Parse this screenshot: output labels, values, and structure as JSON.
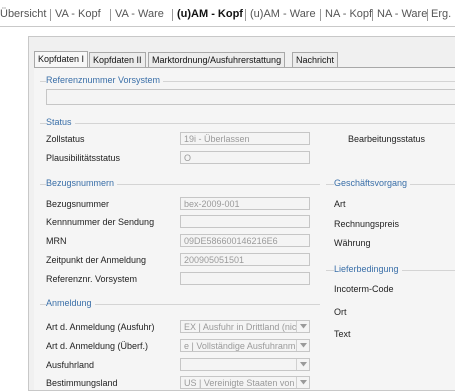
{
  "top_tabs": [
    {
      "label": "Übersicht"
    },
    {
      "label": "VA - Kopf"
    },
    {
      "label": "VA - Ware"
    },
    {
      "label": "(u)AM - Kopf"
    },
    {
      "label": "(u)AM - Ware"
    },
    {
      "label": "NA - Kopf"
    },
    {
      "label": "NA - Ware"
    },
    {
      "label": "Erg."
    }
  ],
  "sub_tabs": [
    {
      "label": "Kopfdaten I"
    },
    {
      "label": "Kopfdaten II"
    },
    {
      "label": "Marktordnung/Ausfuhrerstattung"
    },
    {
      "label": "Nachricht"
    }
  ],
  "referenz": {
    "legend": "Referenznummer Vorsystem",
    "value": ""
  },
  "status": {
    "legend": "Status",
    "zollstatus_label": "Zollstatus",
    "zollstatus_value": "19i - Überlassen",
    "bearbeitungsstatus_label": "Bearbeitungsstatus",
    "plausi_label": "Plausibilitätsstatus",
    "plausi_value": "O"
  },
  "bezug": {
    "legend": "Bezugsnummern",
    "bezugsnummer_label": "Bezugsnummer",
    "bezugsnummer_value": "bex-2009-001",
    "kennnummer_label": "Kennnummer der Sendung",
    "kennnummer_value": "",
    "mrn_label": "MRN",
    "mrn_value": "09DE586600146216E6",
    "zeitpunkt_label": "Zeitpunkt der Anmeldung",
    "zeitpunkt_value": "200905051501",
    "refnr_label": "Referenznr. Vorsystem",
    "refnr_value": ""
  },
  "geschaeft": {
    "legend": "Geschäftsvorgang",
    "art_label": "Art",
    "rechnungspreis_label": "Rechnungspreis",
    "waehrung_label": "Währung"
  },
  "liefer": {
    "legend": "Lieferbedingung",
    "incoterm_label": "Incoterm-Code",
    "ort_label": "Ort",
    "text_label": "Text"
  },
  "anmeldung": {
    "legend": "Anmeldung",
    "art_ausfuhr_label": "Art d. Anmeldung (Ausfuhr)",
    "art_ausfuhr_value": "EX | Ausfuhr in Drittland (nic",
    "art_ueberf_label": "Art d. Anmeldung (Überf.)",
    "art_ueberf_value": "e | Vollständige Ausfuhranm",
    "ausfuhrland_label": "Ausfuhrland",
    "ausfuhrland_value": "",
    "bestimmungsland_label": "Bestimmungsland",
    "bestimmungsland_value": "US | Vereinigte Staaten von"
  }
}
